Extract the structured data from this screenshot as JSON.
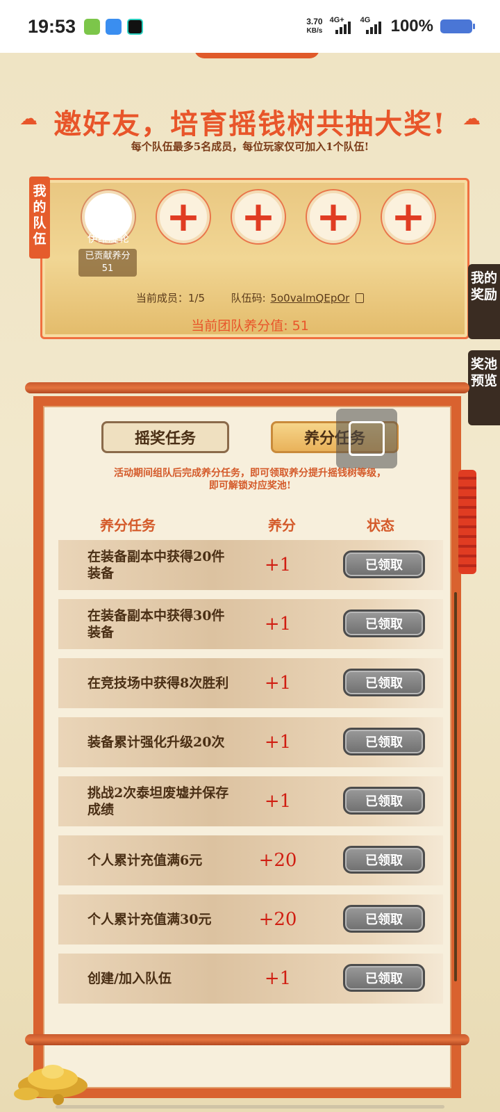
{
  "status_bar": {
    "time": "19:53",
    "net_speed_value": "3.70",
    "net_speed_unit": "KB/s",
    "signal_1_label": "4G+",
    "signal_2_label": "4G",
    "battery": "100%"
  },
  "header": {
    "title": "邀好友，培育摇钱树共抽大奖!",
    "subtitle": "每个队伍最多5名成员，每位玩家仅可加入1个队伍!"
  },
  "team": {
    "tag": "我的队伍",
    "member_name": "伊维旋轮",
    "contrib_label": "已贡献养分",
    "contrib_value": "51",
    "add_symbol": "+",
    "member_count_label": "当前成员：1/5",
    "code_label": "队伍码:",
    "code_value": "5o0valmQEpOr",
    "score_text": "当前团队养分值: 51"
  },
  "side_tabs": {
    "rewards": "我的奖励",
    "pool": "奖池预览"
  },
  "tasks_panel": {
    "tab_lottery": "摇奖任务",
    "tab_nurture": "养分任务",
    "description": "活动期间组队后完成养分任务，即可领取养分提升摇钱树等级，即可解锁对应奖池!",
    "col_task": "养分任务",
    "col_points": "养分",
    "col_status": "状态",
    "rows": [
      {
        "name": "在装备副本中获得20件装备",
        "points": "+1",
        "status": "已领取"
      },
      {
        "name": "在装备副本中获得30件装备",
        "points": "+1",
        "status": "已领取"
      },
      {
        "name": "在竞技场中获得8次胜利",
        "points": "+1",
        "status": "已领取"
      },
      {
        "name": "装备累计强化升级20次",
        "points": "+1",
        "status": "已领取"
      },
      {
        "name": "挑战2次泰坦废墟并保存成绩",
        "points": "+1",
        "status": "已领取"
      },
      {
        "name": "个人累计充值满6元",
        "points": "+20",
        "status": "已领取"
      },
      {
        "name": "个人累计充值满30元",
        "points": "+20",
        "status": "已领取"
      },
      {
        "name": "创建/加入队伍",
        "points": "+1",
        "status": "已领取"
      }
    ]
  },
  "colors": {
    "accent": "#e8552a",
    "panel_border": "#d9622f",
    "points_red": "#d01e12",
    "claimed_gray": "#7f7f7f"
  }
}
